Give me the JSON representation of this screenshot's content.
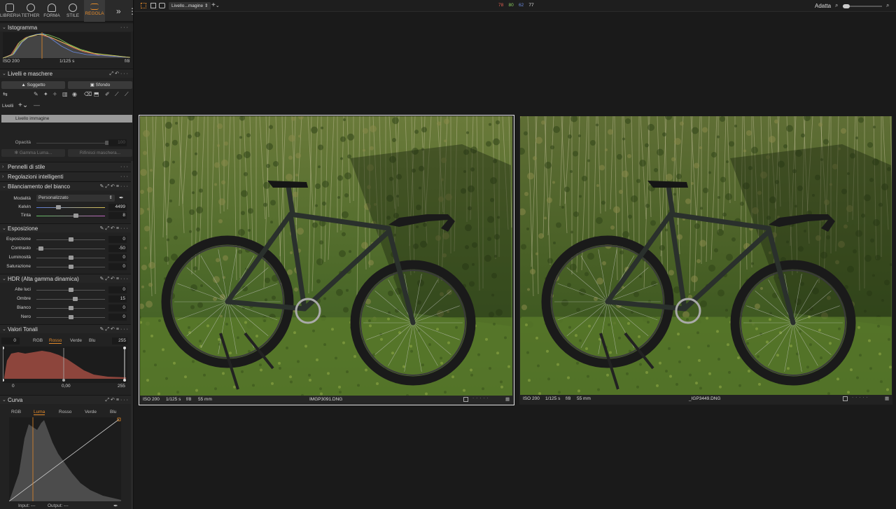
{
  "tool_tabs": [
    {
      "label": "LIBRERIA",
      "icon": "folder-icon"
    },
    {
      "label": "TETHER",
      "icon": "camera-icon"
    },
    {
      "label": "FORMA",
      "icon": "crop-icon"
    },
    {
      "label": "STILE",
      "icon": "style-icon"
    },
    {
      "label": "REGOLA",
      "icon": "adjust-icon",
      "active": true
    }
  ],
  "histogram": {
    "title": "Istogramma",
    "iso": "ISO 200",
    "shutter": "1/125 s",
    "aperture": "f/8"
  },
  "layers": {
    "title": "Livelli e maschere",
    "subject_btn": "Soggetto",
    "background_btn": "Sfondo",
    "layers_label": "Livelli",
    "layer_item": "Livello immagine",
    "opacity_label": "Opacità",
    "opacity_value": "100",
    "luma_range_btn": "Gamma Luma...",
    "refine_mask_btn": "Rifinisci maschera..."
  },
  "sections": {
    "style_brushes": "Pennelli di stile",
    "smart_adjustments": "Regolazioni intelligenti",
    "white_balance": "Bilanciamento del bianco",
    "exposure": "Esposizione",
    "hdr": "HDR (Alta gamma dinamica)",
    "levels": "Valori Tonali",
    "curve": "Curva"
  },
  "white_balance": {
    "mode_label": "Modalità",
    "mode_value": "Personalizzato",
    "kelvin_label": "Kelvin",
    "kelvin_value": "4499",
    "kelvin_pos": 0.3,
    "tint_label": "Tinta",
    "tint_value": "8",
    "tint_pos": 0.58
  },
  "exposure": [
    {
      "label": "Esposizione",
      "value": "0",
      "pos": 0.5
    },
    {
      "label": "Contrasto",
      "value": "-50",
      "pos": 0.03
    },
    {
      "label": "Luminosità",
      "value": "0",
      "pos": 0.5
    },
    {
      "label": "Saturazione",
      "value": "0",
      "pos": 0.5
    }
  ],
  "hdr": [
    {
      "label": "Alte luci",
      "value": "0",
      "pos": 0.5
    },
    {
      "label": "Ombre",
      "value": "15",
      "pos": 0.57
    },
    {
      "label": "Bianco",
      "value": "0",
      "pos": 0.5
    },
    {
      "label": "Nero",
      "value": "0",
      "pos": 0.5
    }
  ],
  "levels": {
    "in_low": "0",
    "in_high": "255",
    "tabs": [
      "RGB",
      "Rosso",
      "Verde",
      "Blu"
    ],
    "active_tab": "Rosso",
    "out_low": "0",
    "mid": "0,00",
    "out_high": "255"
  },
  "curve": {
    "tabs": [
      "RGB",
      "Luma",
      "Rosso",
      "Verde",
      "Blu"
    ],
    "active_tab": "Luma",
    "input_label": "Input:",
    "input_value": "---",
    "output_label": "Output:",
    "output_value": "---"
  },
  "topbar": {
    "variant_select": "Livello...magine",
    "plus": "+",
    "counts": [
      {
        "value": "78",
        "color": "#e06050"
      },
      {
        "value": "80",
        "color": "#8cd060"
      },
      {
        "value": "62",
        "color": "#6a8ae0"
      },
      {
        "value": "77",
        "color": "#dddddd"
      }
    ],
    "zoom_label": "Adatta"
  },
  "viewer": [
    {
      "filename": "IMGP3091.DNG",
      "iso": "ISO 200",
      "shutter": "1/125 s",
      "aperture": "f/8",
      "focal": "55 mm",
      "selected": true
    },
    {
      "filename": "_IGP3449.DNG",
      "iso": "ISO 200",
      "shutter": "1/125 s",
      "aperture": "f/8",
      "focal": "55 mm",
      "selected": false
    }
  ]
}
